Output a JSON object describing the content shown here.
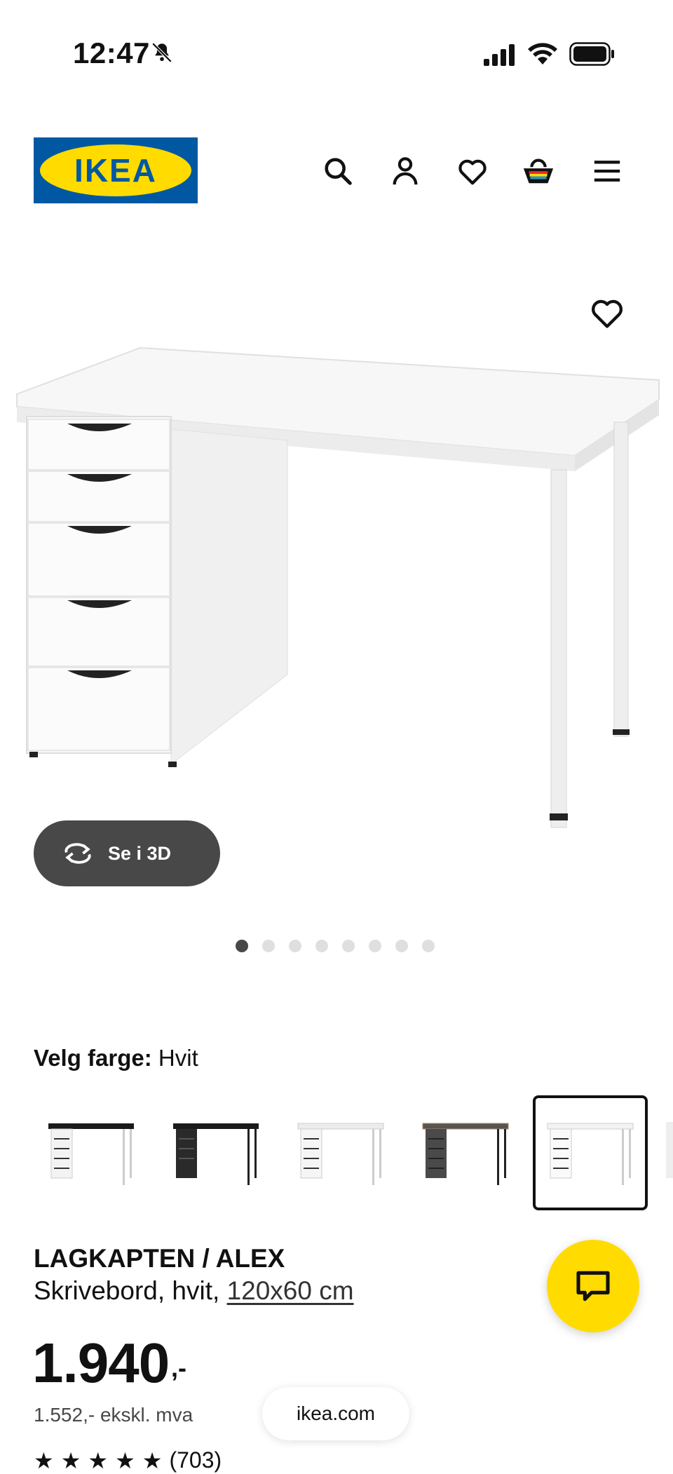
{
  "status_bar": {
    "time": "12:47"
  },
  "header": {
    "logo_text": "IKEA",
    "icons": [
      "search-icon",
      "account-icon",
      "heart-icon",
      "basket-icon",
      "menu-icon"
    ]
  },
  "gallery": {
    "view_3d_label": "Se i 3D",
    "total_images": 8,
    "active_index": 0
  },
  "color_picker": {
    "label": "Velg farge:",
    "value": "Hvit",
    "options": [
      "black-white",
      "black",
      "white-light",
      "grey-black",
      "white"
    ],
    "selected_index": 4
  },
  "product": {
    "name": "LAGKAPTEN / ALEX",
    "description_prefix": "Skrivebord, hvit, ",
    "dimensions": "120x60 cm",
    "price_main": "1.940",
    "price_suffix": ",-",
    "price_ex_vat": "1.552,- ekskl. mva",
    "review_count": "(703)"
  },
  "browser": {
    "url": "ikea.com"
  },
  "colors": {
    "ikea_blue": "#0058a3",
    "ikea_yellow": "#ffdb00",
    "dark_button": "#484848"
  }
}
